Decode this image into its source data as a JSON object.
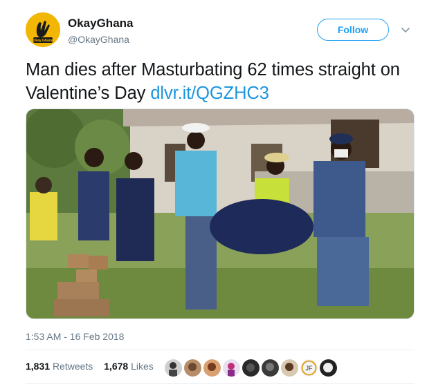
{
  "header": {
    "display_name": "OkayGhana",
    "handle": "@OkayGhana",
    "logo_text": "Okay Ghana",
    "follow_label": "Follow"
  },
  "tweet": {
    "text": "Man dies after Masturbating 62 times straight on Valentine’s Day",
    "link": "dlvr.it/QGZHC3"
  },
  "meta": {
    "timestamp": "1:53 AM - 16 Feb 2018"
  },
  "stats": {
    "retweets_count": "1,831",
    "retweets_label": "Retweets",
    "likes_count": "1,678",
    "likes_label": "Likes"
  },
  "colors": {
    "accent": "#1da1f2",
    "link": "#1b95e0",
    "text": "#14171a",
    "muted": "#657786",
    "logo": "#f2b705"
  },
  "icons": [
    "chevron-down-icon"
  ],
  "liker_avatar_count": 9
}
